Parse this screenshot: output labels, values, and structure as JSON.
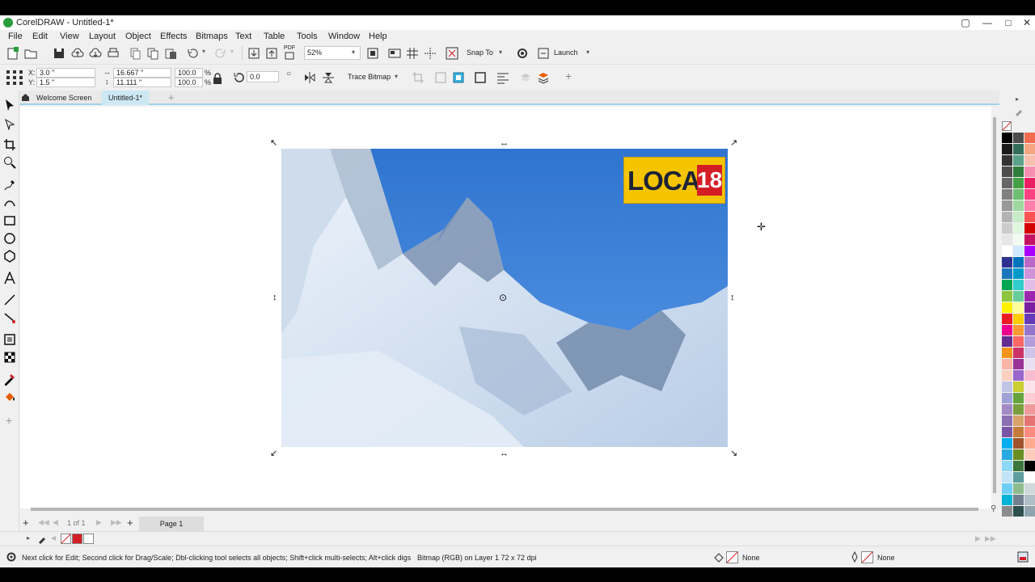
{
  "window": {
    "title": "CorelDRAW - Untitled-1*"
  },
  "menu": [
    "File",
    "Edit",
    "View",
    "Layout",
    "Object",
    "Effects",
    "Bitmaps",
    "Text",
    "Table",
    "Tools",
    "Window",
    "Help"
  ],
  "toolbar": {
    "pdf_label": "PDF",
    "zoom_value": "52%",
    "snap_to_label": "Snap To",
    "launch_label": "Launch"
  },
  "property_bar": {
    "x_label": "X:",
    "x_value": "3.0 \"",
    "y_label": "Y:",
    "y_value": "1.5 \"",
    "width_value": "16.667 \"",
    "height_value": "11.111 \"",
    "scale_w": "100.0",
    "scale_h": "100.0",
    "percent_symbol": "%",
    "rotation_value": "0.0",
    "trace_bitmap_label": "Trace Bitmap"
  },
  "tabs": {
    "welcome": "Welcome Screen",
    "document": "Untitled-1*"
  },
  "image": {
    "logo_text": "LOCAL",
    "logo_number": "18"
  },
  "page_nav": {
    "page_counter": "1 of 1",
    "page_tab": "Page 1"
  },
  "status": {
    "hint": "Next click for Edit; Second click for Drag/Scale; Dbl-clicking tool selects all objects; Shift+click multi-selects; Alt+click digs",
    "object_info": "Bitmap (RGB) on Layer 1 72 x 72 dpi",
    "fill_value": "None",
    "outline_value": "None"
  },
  "colors": {
    "accent": "#9fd3ea",
    "brand_green": "#2a9d3c",
    "logo_yellow": "#f5c400",
    "logo_red": "#d41e26",
    "sky_blue": "#3f86d6"
  },
  "palette": {
    "col1": [
      "#000000",
      "#1a1a1a",
      "#333333",
      "#4d4d4d",
      "#666666",
      "#808080",
      "#999999",
      "#b3b3b3",
      "#cccccc",
      "#e6e6e6",
      "#ffffff",
      "#2e3192",
      "#1b75bc",
      "#00a651",
      "#8dc63f",
      "#fff200",
      "#ed1c24",
      "#ec008c",
      "#662d91",
      "#f7941d",
      "#f9b4a8",
      "#fbd0c0",
      "#c2c4e6",
      "#9ea2d6",
      "#a48ac4",
      "#8c6fb5",
      "#7956a5",
      "#00aeef",
      "#27aae1",
      "#8ed8f8",
      "#c1e4f6",
      "#6dcff6",
      "#00b4d8",
      "#8a8c8e"
    ],
    "col2": [
      "#4d4d4d",
      "#336e5a",
      "#5aa38a",
      "#2f7d3c",
      "#43a047",
      "#6fbf73",
      "#9fd89f",
      "#c6ebc6",
      "#e0f5e0",
      "#f2faf2",
      "#d0e8ff",
      "#0072bc",
      "#0099cc",
      "#33cccc",
      "#66cc99",
      "#ffff99",
      "#ffcc00",
      "#ff9933",
      "#ff6666",
      "#cc3366",
      "#993399",
      "#9966cc",
      "#cccc33",
      "#66a33d",
      "#7a9e3d",
      "#d8a26a",
      "#c47a3a",
      "#a0522d",
      "#6b8e23",
      "#3c763d",
      "#5f9ea0",
      "#8fbc8f",
      "#708090",
      "#2f4f4f"
    ],
    "col3": [
      "#f26c4f",
      "#f4a582",
      "#f9c0b0",
      "#f48fb1",
      "#e91e63",
      "#ff4081",
      "#ff80ab",
      "#ff5252",
      "#d50000",
      "#c51162",
      "#aa00ff",
      "#ba68c8",
      "#ce93d8",
      "#e1bee7",
      "#9c27b0",
      "#7b1fa2",
      "#673ab7",
      "#9575cd",
      "#b39ddb",
      "#d1c4e9",
      "#e8e0f0",
      "#f8bbd0",
      "#fce4ec",
      "#ffcdd2",
      "#ef9a9a",
      "#e57373",
      "#ff8a80",
      "#ffab91",
      "#ffccbc",
      "#000000",
      "#ffffff",
      "#cfd8dc",
      "#b0bec5",
      "#90a4ae"
    ]
  }
}
